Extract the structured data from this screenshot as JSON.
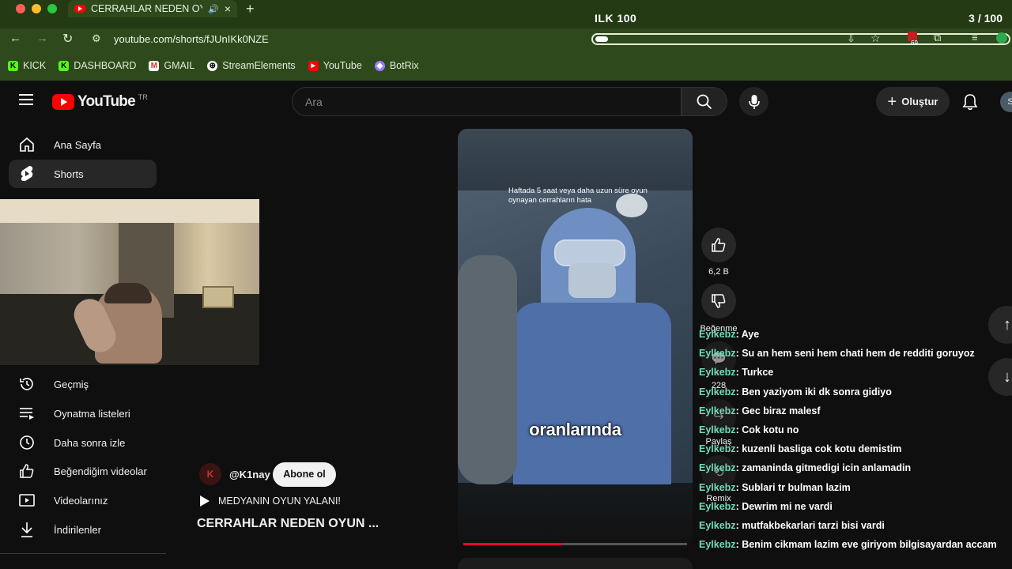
{
  "browser": {
    "tab_title": "CERRAHLAR NEDEN OYUN",
    "url": "youtube.com/shorts/fJUnIKk0NZE",
    "bookmarks": [
      "KICK",
      "DASHBOARD",
      "GMAIL",
      "StreamElements",
      "YouTube",
      "BotRix"
    ],
    "extension_badge": "69"
  },
  "overlay": {
    "title": "ILK 100",
    "count": "3 / 100",
    "progress_fraction": 0.03
  },
  "youtube": {
    "logo_text": "YouTube",
    "logo_region": "TR",
    "search_placeholder": "Ara",
    "create_label": "Oluştur",
    "sidebar_top": [
      "Ana Sayfa",
      "Shorts"
    ],
    "sidebar_bottom": [
      "Geçmiş",
      "Oynatma listeleri",
      "Daha sonra izle",
      "Beğendiğim videolar",
      "Videolarınız",
      "İndirilenler"
    ]
  },
  "short": {
    "caption_top": "Haftada 5 saat veya daha uzun süre oyun oynayan cerrahların hata",
    "caption_big": "oranlarında",
    "channel": "@K1nay",
    "subscribe": "Abone ol",
    "playlist": "MEDYANIN OYUN YALANI!",
    "title": "CERRAHLAR NEDEN OYUN ...",
    "likes": "6,2 B",
    "dislike_label": "Beğenme",
    "comments": "228",
    "share_label": "Paylaş",
    "remix_label": "Remix",
    "progress_fraction": 0.44
  },
  "chat": [
    {
      "user": "Eylkebz",
      "msg": ": Aye"
    },
    {
      "user": "Eylkebz",
      "msg": ": Su an hem seni hem chati hem de redditi goruyoz"
    },
    {
      "user": "Eylkebz",
      "msg": ": Turkce"
    },
    {
      "user": "Eylkebz",
      "msg": ": Ben yaziyom iki dk sonra gidiyo"
    },
    {
      "user": "Eylkebz",
      "msg": ": Gec biraz malesf"
    },
    {
      "user": "Eylkebz",
      "msg": ": Cok kotu no"
    },
    {
      "user": "Eylkebz",
      "msg": ": kuzenli basliga cok kotu demistim"
    },
    {
      "user": "Eylkebz",
      "msg": ": zamaninda gitmedigi icin anlamadin"
    },
    {
      "user": "Eylkebz",
      "msg": ": Sublari tr bulman lazim"
    },
    {
      "user": "Eylkebz",
      "msg": ": Dewrim mi ne vardi"
    },
    {
      "user": "Eylkebz",
      "msg": ": mutfakbekarlari tarzi bisi vardi"
    },
    {
      "user": "Eylkebz",
      "msg": ": Benim cikmam lazim eve giriyom bilgisayardan accam"
    }
  ]
}
